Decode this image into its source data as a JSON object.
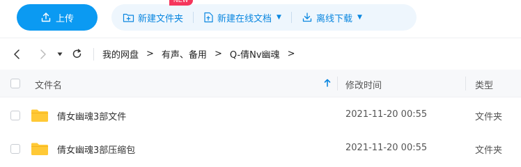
{
  "toolbar": {
    "upload_label": "上传",
    "new_folder_label": "新建文件夹",
    "new_online_doc_label": "新建在线文档",
    "new_badge": "NEW",
    "offline_download_label": "离线下载"
  },
  "breadcrumb": {
    "items": [
      "我的网盘",
      "有声、备用",
      "Q-倩Nv幽魂"
    ],
    "separator": ">"
  },
  "table": {
    "columns": {
      "name": "文件名",
      "modified": "修改时间",
      "type": "类型"
    },
    "rows": [
      {
        "name": "倩女幽魂3部文件",
        "modified": "2021-11-20 00:55",
        "type": "文件夹"
      },
      {
        "name": "倩女幽魂3部压缩包",
        "modified": "2021-11-20 00:55",
        "type": "文件夹"
      }
    ]
  },
  "colors": {
    "accent": "#0b9af2",
    "accent_text": "#0b87e0",
    "badge": "#f5365c",
    "folder": "#ffc936"
  }
}
